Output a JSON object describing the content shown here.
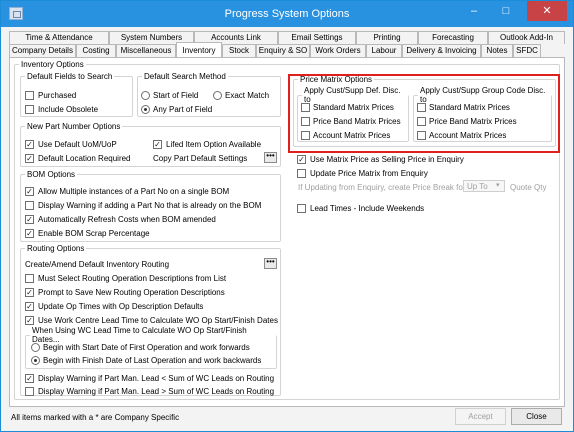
{
  "window": {
    "title": "Progress System Options",
    "minimize": "–",
    "maximize": "□",
    "close": "✕"
  },
  "tabs": {
    "row1": [
      "Time & Attendance",
      "System Numbers",
      "Accounts Link",
      "Email Settings",
      "Printing",
      "Forecasting",
      "Outlook Add-In"
    ],
    "row2": [
      "Company Details",
      "Costing",
      "Miscellaneous",
      "Inventory",
      "Stock",
      "Enquiry & SO",
      "Work Orders",
      "Labour",
      "Delivery & Invoicing",
      "Notes",
      "SFDC"
    ],
    "active": "Inventory"
  },
  "inventory_options": {
    "legend": "Inventory Options",
    "default_fields": {
      "legend": "Default Fields to Search",
      "purchased": "Purchased",
      "include_obsolete": "Include Obsolete"
    },
    "search_method": {
      "legend": "Default Search Method",
      "start_of_field": "Start of Field",
      "exact_match": "Exact Match",
      "any_part_of_field": "Any Part of Field",
      "selected": "any_part_of_field"
    },
    "new_part": {
      "legend": "New Part Number Options",
      "use_default_uom": "Use Default UoM/UoP",
      "lifed_item": "Lifed Item Option Available",
      "default_location": "Default Location Required",
      "copy_defaults": "Copy Part Default Settings",
      "dots": "•••"
    },
    "bom": {
      "legend": "BOM Options",
      "items": [
        {
          "label": "Allow Multiple instances of a Part No on a single BOM",
          "checked": true
        },
        {
          "label": "Display Warning if adding a Part No that is already on the BOM",
          "checked": false
        },
        {
          "label": "Automatically Refresh Costs when BOM amended",
          "checked": true
        },
        {
          "label": "Enable BOM Scrap Percentage",
          "checked": true
        }
      ]
    },
    "routing": {
      "legend": "Routing Options",
      "create_amend": "Create/Amend Default Inventory Routing",
      "dots": "•••",
      "items": [
        {
          "label": "Must Select Routing Operation Descriptions from List",
          "checked": false
        },
        {
          "label": "Prompt to Save New Routing Operation Descriptions",
          "checked": true
        },
        {
          "label": "Update Op Times with Op Description Defaults",
          "checked": true
        },
        {
          "label": "Use Work Centre Lead Time to Calculate WO Op Start/Finish Dates",
          "checked": true
        }
      ],
      "wc_group": {
        "legend": "When Using WC Lead Time to Calculate WO Op Start/Finish Dates...",
        "opt1": "Begin with Start Date of First Operation and work forwards",
        "opt2": "Begin with Finish Date of Last Operation and work backwards",
        "selected": "opt2"
      },
      "warnings": [
        {
          "label": "Display Warning if Part Man. Lead < Sum of WC Leads on Routing",
          "checked": true
        },
        {
          "label": "Display Warning if Part Man. Lead > Sum of WC Leads on Routing",
          "checked": false
        }
      ]
    },
    "price_matrix": {
      "legend": "Price Matrix Options",
      "cust_supp": {
        "legend": "Apply Cust/Supp Def. Disc. to",
        "items": [
          "Standard Matrix Prices",
          "Price Band Matrix Prices",
          "Account Matrix Prices"
        ]
      },
      "cust_supp_group": {
        "legend": "Apply Cust/Supp Group Code Disc. to",
        "items": [
          "Standard Matrix Prices",
          "Price Band Matrix Prices",
          "Account Matrix Prices"
        ]
      }
    },
    "enquiry": {
      "use_matrix_price": "Use Matrix Price as Selling Price in Enquiry",
      "update_price": "Update Price Matrix from Enquiry",
      "if_updating": "If Updating from Enquiry, create Price Break for",
      "up_to_value": "Up To",
      "quote_qty": "Quote Qty"
    },
    "lead_times": "Lead Times - Include Weekends"
  },
  "footer": {
    "note": "All items marked with a * are Company Specific",
    "accept": "Accept",
    "close": "Close"
  },
  "colors": {
    "titlebar": "#2992e0",
    "close": "#c74345",
    "highlight": "#e0201c"
  }
}
